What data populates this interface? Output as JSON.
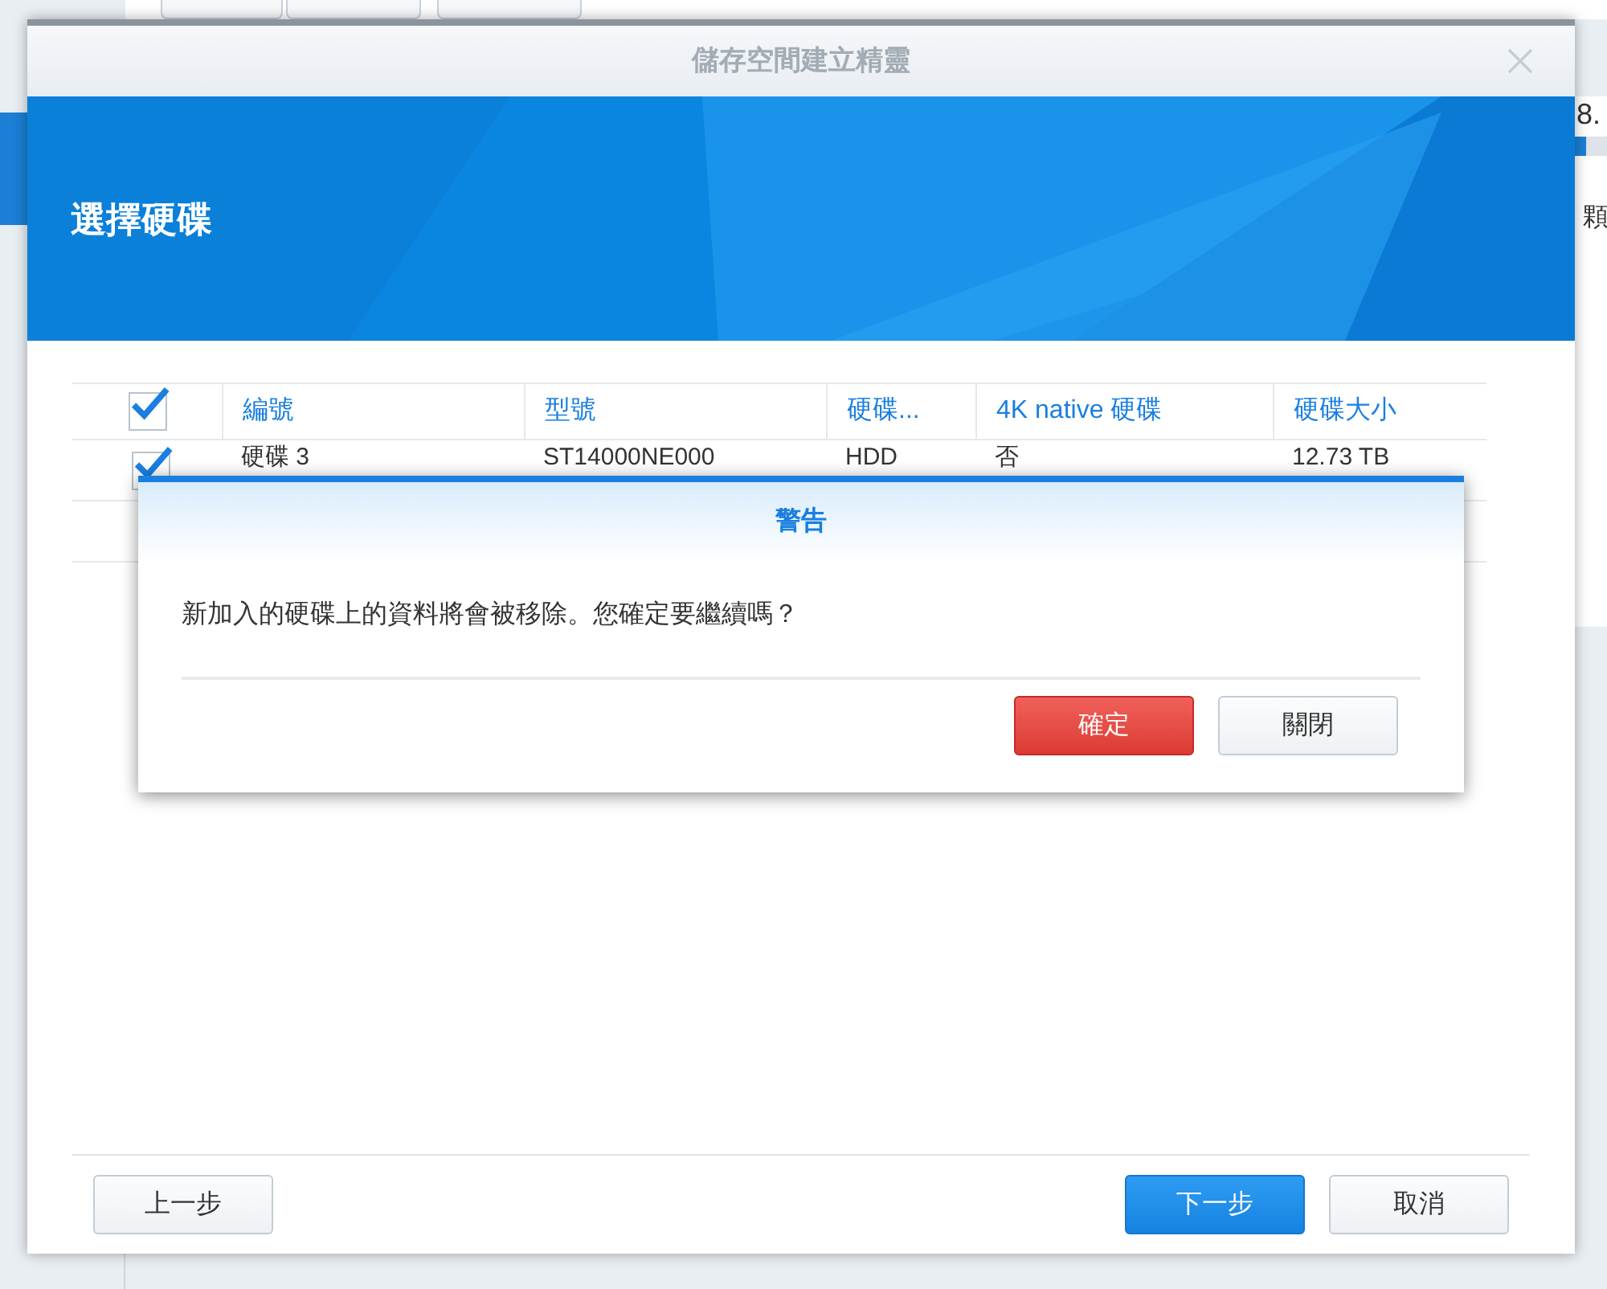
{
  "background": {
    "texts": [
      "8.",
      "顆"
    ],
    "progress": {
      "level": 0.35
    }
  },
  "window": {
    "title": "儲存空間建立精靈",
    "heading": "選擇硬碟"
  },
  "table": {
    "header_checked": true,
    "columns": [
      "編號",
      "型號",
      "硬碟...",
      "4K native 硬碟",
      "硬碟大小"
    ],
    "rows": [
      {
        "checked": true,
        "cells": [
          "硬碟 3",
          "ST14000NE000",
          "HDD",
          "否",
          "12.73 TB"
        ]
      }
    ]
  },
  "dialog": {
    "title": "警告",
    "message": "新加入的硬碟上的資料將會被移除。您確定要繼續嗎？",
    "buttons": [
      {
        "label": "確定",
        "kind": "danger"
      },
      {
        "label": "關閉",
        "kind": "normal"
      }
    ]
  },
  "footer": {
    "buttons": [
      {
        "label": "上一步",
        "kind": "normal"
      },
      {
        "label": "下一步",
        "kind": "primary"
      },
      {
        "label": "取消",
        "kind": "normal"
      }
    ]
  }
}
